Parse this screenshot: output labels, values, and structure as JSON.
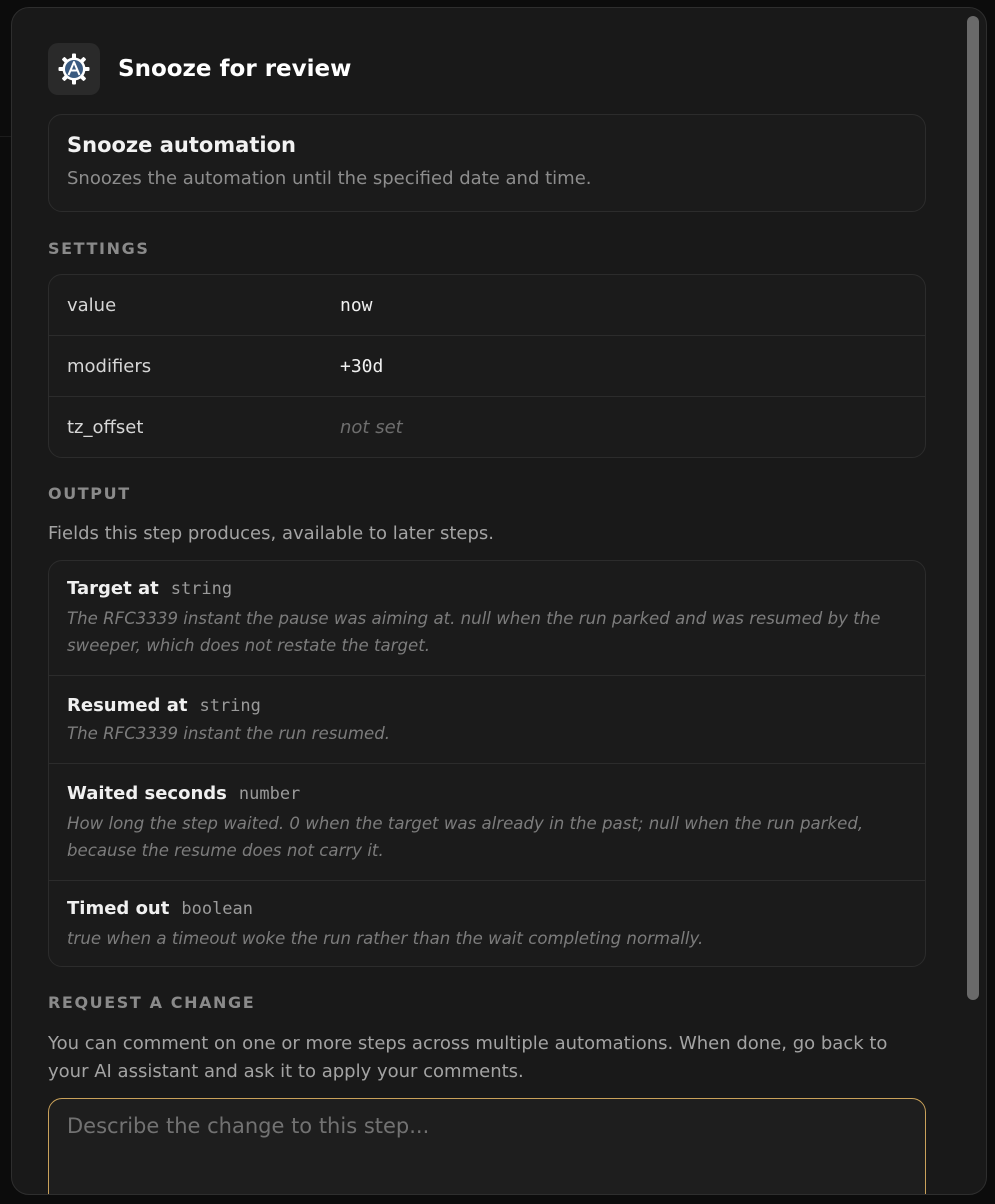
{
  "header": {
    "title": "Snooze for review",
    "icon": "automation-gear-icon"
  },
  "action": {
    "title": "Snooze automation",
    "description": "Snoozes the automation until the specified date and time."
  },
  "settings": {
    "label": "SETTINGS",
    "rows": [
      {
        "key": "value",
        "value": "now",
        "unset": false
      },
      {
        "key": "modifiers",
        "value": "+30d",
        "unset": false
      },
      {
        "key": "tz_offset",
        "value": "not set",
        "unset": true
      }
    ]
  },
  "output": {
    "label": "OUTPUT",
    "description": "Fields this step produces, available to later steps.",
    "fields": [
      {
        "name": "Target at",
        "type": "string",
        "description": "The RFC3339 instant the pause was aiming at. null when the run parked and was resumed by the sweeper, which does not restate the target."
      },
      {
        "name": "Resumed at",
        "type": "string",
        "description": "The RFC3339 instant the run resumed."
      },
      {
        "name": "Waited seconds",
        "type": "number",
        "description": "How long the step waited. 0 when the target was already in the past; null when the run parked, because the resume does not carry it."
      },
      {
        "name": "Timed out",
        "type": "boolean",
        "description": "true when a timeout woke the run rather than the wait completing normally."
      }
    ]
  },
  "request": {
    "label": "REQUEST A CHANGE",
    "description": "You can comment on one or more steps across multiple automations. When done, go back to your AI assistant and ask it to apply your comments.",
    "placeholder": "Describe the change to this step..."
  },
  "colors": {
    "accent": "#c9a15a",
    "panel": "#191919",
    "background": "#0c0c0c"
  }
}
